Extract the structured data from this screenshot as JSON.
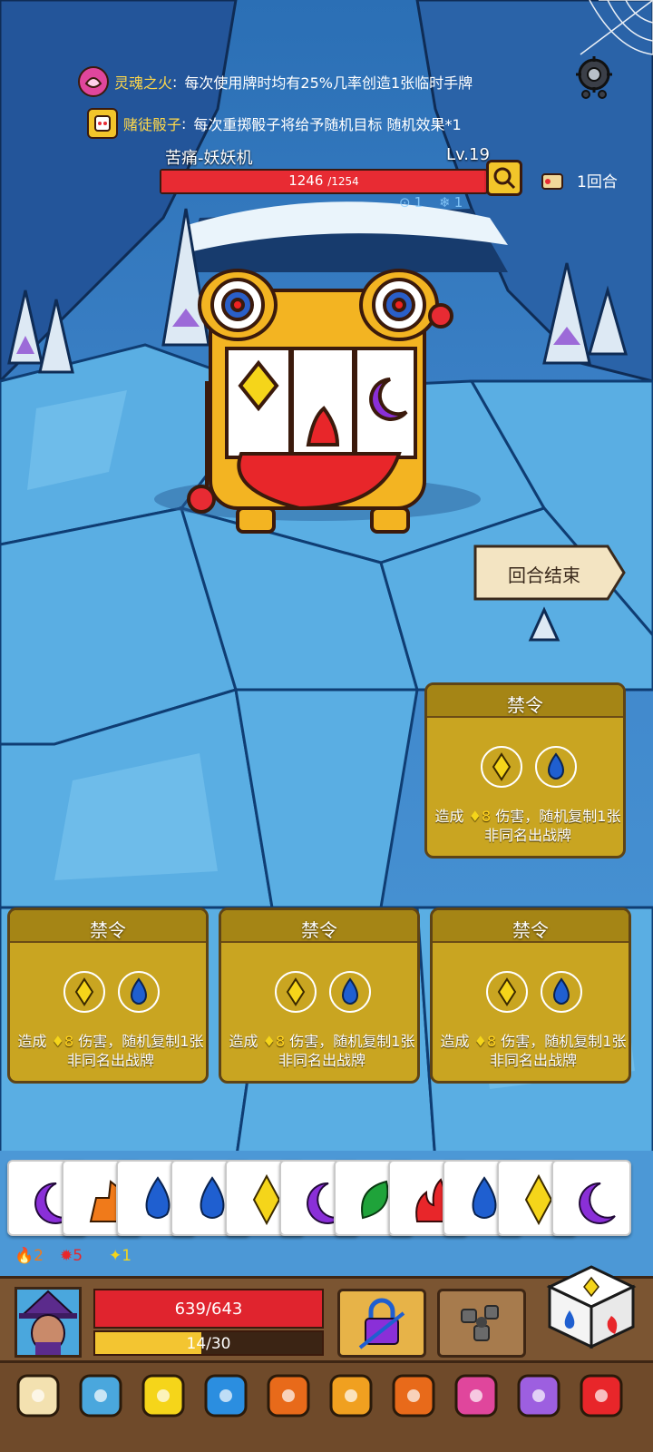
{
  "relics": [
    {
      "name": "灵魂之火",
      "colon": ":",
      "desc": "每次使用牌时均有25%几率创造1张临时手牌",
      "icon": "soul-fire-icon",
      "color": "#e0469c"
    },
    {
      "name": "赌徒骰子",
      "colon": ":",
      "desc": "每次重掷骰子将给予随机目标 随机效果*1",
      "icon": "gambler-dice-icon",
      "color": "#f2c52a"
    }
  ],
  "enemy": {
    "name": "苦痛-妖妖机",
    "level": "Lv.19",
    "hp": "1246",
    "hp_max": "/1254",
    "hp_fraction": 0.9936,
    "turn": "1回合",
    "intent_value": "1",
    "freeze_value": "1"
  },
  "end_turn_label": "回合结束",
  "cards": [
    {
      "title": "禁令",
      "desc_a": "造成 ",
      "num": "8",
      "desc_b": " 伤害，随机复制1张非同名出战牌"
    },
    {
      "title": "禁令",
      "desc_a": "造成 ",
      "num": "8",
      "desc_b": " 伤害，随机复制1张非同名出战牌"
    },
    {
      "title": "禁令",
      "desc_a": "造成 ",
      "num": "8",
      "desc_b": " 伤害，随机复制1张非同名出战牌"
    },
    {
      "title": "禁令",
      "desc_a": "造成 ",
      "num": "8",
      "desc_b": " 伤害，随机复制1张非同名出战牌"
    }
  ],
  "hand": [
    "moon",
    "orange",
    "water",
    "water",
    "diamond",
    "moon",
    "leaf",
    "fire",
    "water",
    "diamond",
    "moon"
  ],
  "status": {
    "burn": "2",
    "gear": "5",
    "star": "1"
  },
  "player": {
    "hp": "639/643",
    "energy": "14/30",
    "energy_fraction": 0.4667
  },
  "colors": {
    "diamond": "#f5d51a",
    "water": "#1f5fd0",
    "moon": "#8a2fd8",
    "fire": "#e8262a",
    "leaf": "#1fa33a",
    "orange": "#f07a1a",
    "card": "#c9a521"
  },
  "dice_bar": [
    "target-icon",
    "blue-slime-icon",
    "yellow-dice-icon",
    "blue-dice-icon",
    "fire-spike-dice-icon",
    "flame-orb-icon",
    "fire-bundle-icon",
    "pink-slime-icon",
    "purple-dice-icon",
    "red-dice-icon"
  ]
}
